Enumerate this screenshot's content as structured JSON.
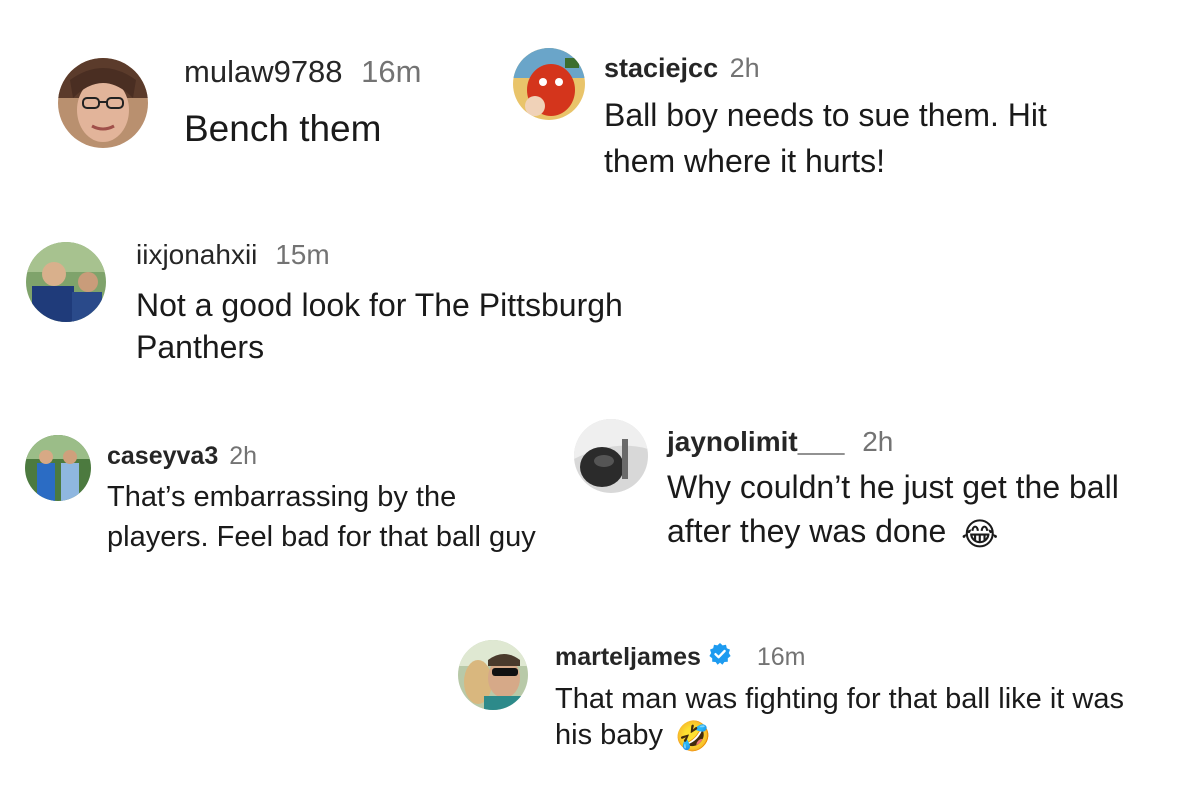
{
  "comments": [
    {
      "username": "mulaw9788",
      "time": "16m",
      "text": "Bench them",
      "avatar": "avatar-woman-glasses"
    },
    {
      "username": "staciejcc",
      "time": "2h",
      "text": "Ball boy needs to sue them. Hit them where it hurts!",
      "avatar": "avatar-red-mascot"
    },
    {
      "username": "iixjonahxii",
      "time": "15m",
      "text": "Not a good look for The Pittsburgh Panthers",
      "avatar": "avatar-two-men-outdoors"
    },
    {
      "username": "caseyva3",
      "time": "2h",
      "text": "That’s embarrassing by the players. Feel bad for that ball guy",
      "avatar": "avatar-two-people-blue"
    },
    {
      "username": "jaynolimit___",
      "time": "2h",
      "text": "Why couldn’t he just get the ball after they was done",
      "avatar": "avatar-grayscale-object",
      "emoji": "😂"
    },
    {
      "username": "marteljames",
      "time": "16m",
      "text": "That man was fighting for that ball like it was his baby",
      "avatar": "avatar-man-sunglasses",
      "verified": true,
      "emoji": "🤣"
    }
  ],
  "colors": {
    "username": "#262626",
    "timestamp": "#737373",
    "text": "#1a1a1a",
    "verified_badge": "#1d9bf0",
    "background": "#ffffff"
  },
  "icons": {
    "verified": "verified-badge-icon",
    "laughing_emoji": "tears-of-joy-emoji-icon",
    "rofl_emoji": "rolling-on-floor-laughing-emoji-icon"
  }
}
